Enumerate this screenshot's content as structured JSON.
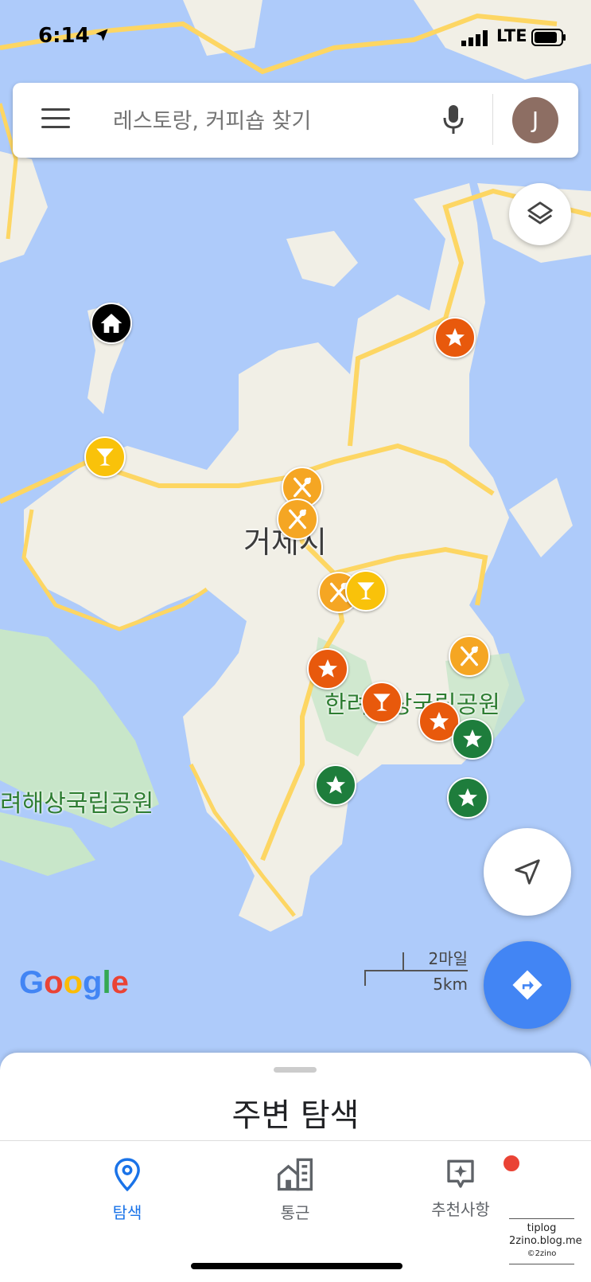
{
  "status_bar": {
    "time": "6:14",
    "network": "LTE"
  },
  "search": {
    "placeholder": "레스토랑, 커피숍 찾기",
    "avatar_initial": "J"
  },
  "map": {
    "city_label": "거제시",
    "park_label_1": "한려해상국립공원",
    "park_label_2": "려해상국립공원",
    "logo": "Google",
    "scale_miles": "2마일",
    "scale_km": "5km",
    "markers": [
      {
        "type": "home",
        "color": "#000000",
        "icon": "home-icon"
      },
      {
        "type": "bar",
        "color": "#f9c20a",
        "icon": "cocktail-icon"
      },
      {
        "type": "favorite",
        "color": "#e8590c",
        "icon": "star-icon"
      },
      {
        "type": "restaurant",
        "color": "#f5a623",
        "icon": "fork-knife-icon"
      },
      {
        "type": "restaurant",
        "color": "#f5a623",
        "icon": "fork-knife-icon"
      },
      {
        "type": "restaurant",
        "color": "#f5a623",
        "icon": "fork-knife-icon"
      },
      {
        "type": "bar",
        "color": "#f9c20a",
        "icon": "cocktail-icon"
      },
      {
        "type": "restaurant",
        "color": "#f5a623",
        "icon": "fork-knife-icon"
      },
      {
        "type": "favorite",
        "color": "#e8590c",
        "icon": "star-icon"
      },
      {
        "type": "bar",
        "color": "#e8590c",
        "icon": "cocktail-icon"
      },
      {
        "type": "favorite",
        "color": "#e8590c",
        "icon": "star-icon"
      },
      {
        "type": "saved",
        "color": "#1e7d3c",
        "icon": "star-icon"
      },
      {
        "type": "saved",
        "color": "#1e7d3c",
        "icon": "star-icon"
      },
      {
        "type": "saved",
        "color": "#1e7d3c",
        "icon": "star-icon"
      }
    ]
  },
  "sheet": {
    "title": "주변 탐색"
  },
  "nav": {
    "explore": "탐색",
    "commute": "통근",
    "for_you": "추천사항"
  },
  "watermark": {
    "line1": "tiplog",
    "line2": "2zino.blog.me",
    "line3": "©2zino"
  }
}
